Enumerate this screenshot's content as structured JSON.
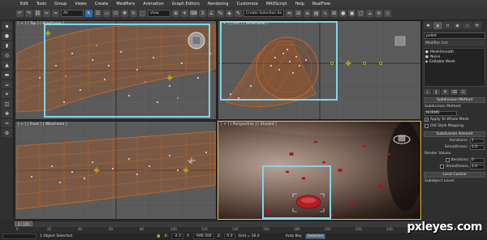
{
  "app": {
    "logo_glyph": "◆"
  },
  "menu": [
    "Edit",
    "Tools",
    "Group",
    "Views",
    "Create",
    "Modifiers",
    "Animation",
    "Graph Editors",
    "Rendering",
    "Customize",
    "MAXScript",
    "Help",
    "RealFlow"
  ],
  "toolbar": {
    "selection_filter": "All",
    "view_dropdown": "View",
    "named_selection": "Create Selection Se"
  },
  "viewports": {
    "top_left": {
      "label": "[ + ] [ Top ] [ Wireframe ]"
    },
    "top_right": {
      "label": "[ + ] [ Left ] [ Wireframe ]"
    },
    "bottom_left": {
      "label": "[ + ] [ Front ] [ Wireframe ]"
    },
    "bottom_right": {
      "label": "[ + ] [ Perspective ] [ Shaded ]"
    }
  },
  "panel": {
    "object_name": "pellet",
    "modifier_list": "Modifier List",
    "stack": [
      {
        "label": "MeshSmooth",
        "selected": false
      },
      {
        "label": "Noise",
        "selected": false
      },
      {
        "label": "Editable Mesh",
        "selected": false
      }
    ],
    "subdivision_method": {
      "title": "Subdivision Method",
      "method_label": "Subdivision Method:",
      "method_value": "NURMS",
      "apply_whole_mesh": "Apply To Whole Mesh",
      "old_style_mapping": "Old Style Mapping"
    },
    "subdivision_amount": {
      "title": "Subdivision Amount",
      "iterations_label": "Iterations:",
      "iterations_value": "1",
      "smoothness_label": "Smoothness:",
      "smoothness_value": "1.0",
      "render_values": "Render Values:",
      "r_iterations_label": "Iterations",
      "r_iterations_value": "0",
      "r_smoothness_label": "Smoothness",
      "r_smoothness_value": "1.0"
    },
    "local_control": {
      "title": "Local Control",
      "subobject_level": "Subobject Level:"
    }
  },
  "timeline": {
    "frame_display": "0 / 100",
    "ruler_ticks": [
      "0",
      "20",
      "40",
      "60",
      "80",
      "100",
      "120",
      "140",
      "160",
      "180",
      "200",
      "220",
      "240"
    ]
  },
  "status": {
    "selection_text": "1 Object Selected",
    "x_label": "X:",
    "x_value": "-2.3",
    "y_label": "Y:",
    "y_value": "-946.504",
    "z_label": "Z:",
    "z_value": "0.0",
    "grid": "Grid = 10.0",
    "autokey": "Auto Key",
    "selected_dropdown": "Selected"
  },
  "watermark": {
    "text_main": "pxleyes",
    "text_dot": ".",
    "text_tail": "com"
  },
  "colors": {
    "highlight_box": "#7fd6e8",
    "mesh_orange": "#c8641e",
    "active_vp_border": "#e8c34a"
  }
}
